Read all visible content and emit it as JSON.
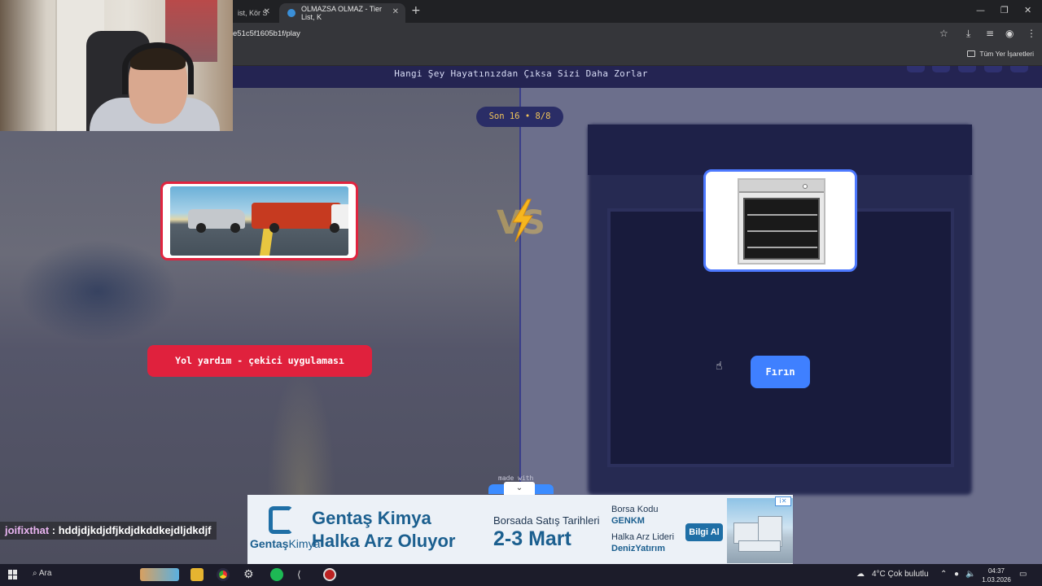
{
  "browser": {
    "tabs": [
      {
        "title": "ist, Kör S"
      },
      {
        "title": "OLMAZSA OLMAZ - Tier List, K"
      }
    ],
    "url": "e51c5f1605b1f/play",
    "bookmarks_label": "Tüm Yer İşaretleri"
  },
  "game": {
    "title": "Hangi Şey Hayatınızdan Çıksa Sizi Daha Zorlar",
    "round_badge": "Son 16 • 8/8",
    "left_option": {
      "label": "Yol yardım - çekici uygulaması",
      "accent": "#e0213d"
    },
    "right_option": {
      "label": "Fırın",
      "accent": "#3f80ff"
    },
    "footer_made_with": "made with"
  },
  "ad": {
    "headline_1": "Gentaş Kimya",
    "headline_2": "Halka Arz Oluyor",
    "logo_text_bold": "Gentaş",
    "logo_text_light": "Kimya",
    "sub_1": "Borsada Satış Tarihleri",
    "sub_2": "2-3 Mart",
    "right_1": "Borsa Kodu",
    "right_2": "GENKM",
    "right_3": "Halka Arz Lideri",
    "right_4": "DenizYatırım",
    "button": "Bilgi Al"
  },
  "chat": {
    "user": "joifixthat",
    "separator": " : ",
    "message": "hddjdjkdjdfjkdjdkddkejdljdkdjf"
  },
  "taskbar": {
    "search_label": "Ara",
    "weather": "4°C  Çok bulutlu",
    "time": "04:37",
    "date": "1.03.2026"
  }
}
